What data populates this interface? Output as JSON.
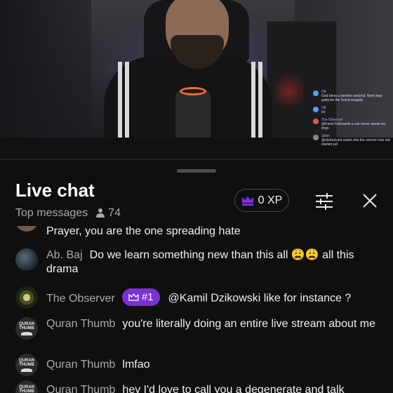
{
  "stream": {
    "overlay_chat": [
      {
        "name": "Ott",
        "text": "God bless u brother welcmd. Next stop gotta be the Sunni masjids"
      },
      {
        "name": "Ott",
        "text": "lol"
      },
      {
        "name": "The Observer",
        "text": "@Kamil Dzikowski u can never speak my lingo"
      },
      {
        "name": "Jatim",
        "text": "@shuhuLyhd salam ribs the sermon has not started yet"
      }
    ]
  },
  "chat": {
    "title": "Live chat",
    "mode_label": "Top messages",
    "viewer_count": "74",
    "xp_label": "0 XP",
    "accent": "#7b2fd6",
    "messages": [
      {
        "author": "",
        "text": "Prayer, you are the one spreading hate",
        "avatar": "partial"
      },
      {
        "author": "Ab. Baj",
        "text": "Do we learn something new than this all 😩😩 all this drama",
        "avatar": "abbaj"
      },
      {
        "author": "The Observer",
        "badge": "#1",
        "text": "@Kamil Dzikowski like for instance ?",
        "avatar": "observer"
      },
      {
        "author": "Quran Thumb",
        "text": "you're literally doing an entire live stream about me",
        "avatar": "quran"
      },
      {
        "author": "Quran Thumb",
        "text": "lmfao",
        "avatar": "quran"
      },
      {
        "author": "Quran Thumb",
        "text": "hey I'd love to call you a degenerate and talk",
        "avatar": "quran"
      }
    ],
    "quran_avatar_text": [
      "QURAN",
      "THUMB"
    ]
  }
}
